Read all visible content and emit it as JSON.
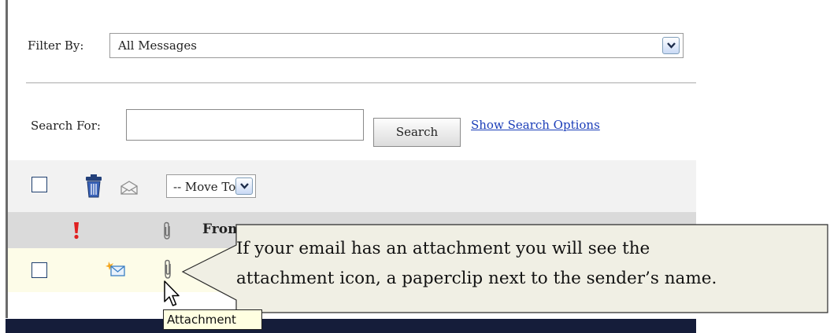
{
  "filter": {
    "label": "Filter By:",
    "selected": "All Messages"
  },
  "search": {
    "label": "Search For:",
    "input_value": "",
    "button_label": "Search",
    "options_link": "Show Search Options"
  },
  "toolbar": {
    "move_to_selected": "-- Move To --",
    "icons": [
      "checkbox",
      "trash-icon",
      "envelope-icon",
      "dropdown"
    ]
  },
  "message_list": {
    "columns": [
      "priority",
      "attachment",
      "From"
    ],
    "from_header": "From",
    "rows": [
      {
        "icons": [
          "new-mail-icon",
          "paperclip-icon"
        ],
        "has_attachment": true
      }
    ]
  },
  "tooltip": {
    "text": "Attachment"
  },
  "callout": {
    "line1": "If your email has an attachment you will see the",
    "line2": "attachment icon, a paperclip next to the sender’s name."
  },
  "colors": {
    "link": "#1a3db8",
    "toolbar_bg": "#f2f2f2",
    "header_bg": "#dadada",
    "unread_row_bg": "#fdfce8",
    "callout_bg": "#f0efe4",
    "priority_red": "#e02020",
    "bottom_bar": "#151d3a"
  }
}
